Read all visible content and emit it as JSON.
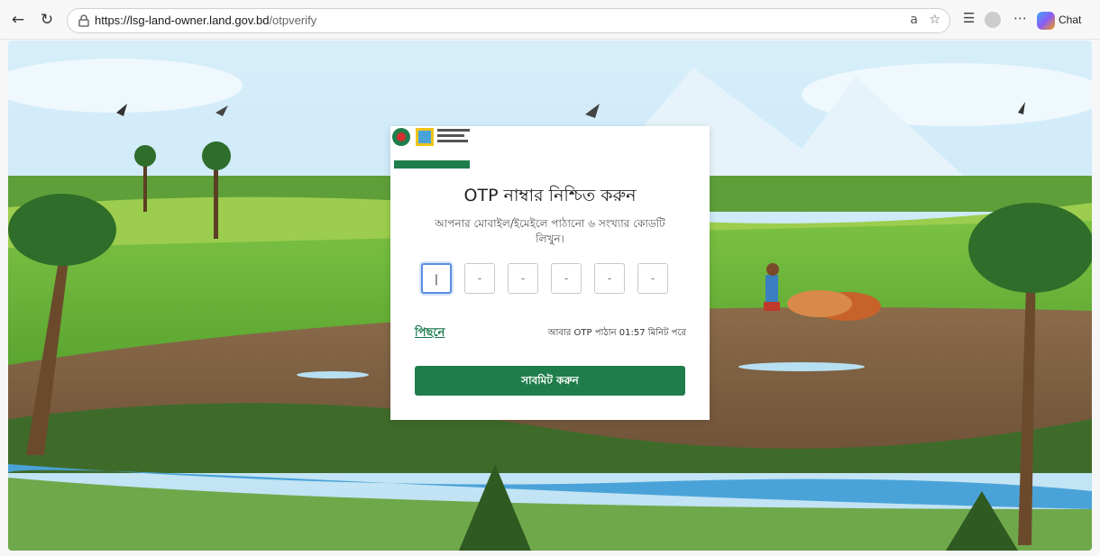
{
  "browser": {
    "url_host": "https://lsg-land-owner.land.gov.bd",
    "url_path": "/otpverify",
    "chat_label": "Chat"
  },
  "page": {
    "title": "OTP নাম্বার নিশ্চিত করুন",
    "subtitle": "আপনার মোবাইল/ইমেইলে পাঠানো ৬ সংখ্যার কোডটি লিখুন।",
    "otp_placeholders": [
      "|",
      "-",
      "-",
      "-",
      "-",
      "-"
    ],
    "back_label": "পিছনে",
    "resend_text": "আবার OTP পাঠান 01:57 মিনিট পরে",
    "submit_label": "সাবমিট করুন"
  },
  "logo": {
    "line1": "ভূমি ব্যবস্থাপনা অটোমেশন প্রকল্প",
    "line2": "ভূমি মন্ত্রণালয়"
  },
  "colors": {
    "accent": "#1e7d4b",
    "focus": "#5a8de0"
  }
}
